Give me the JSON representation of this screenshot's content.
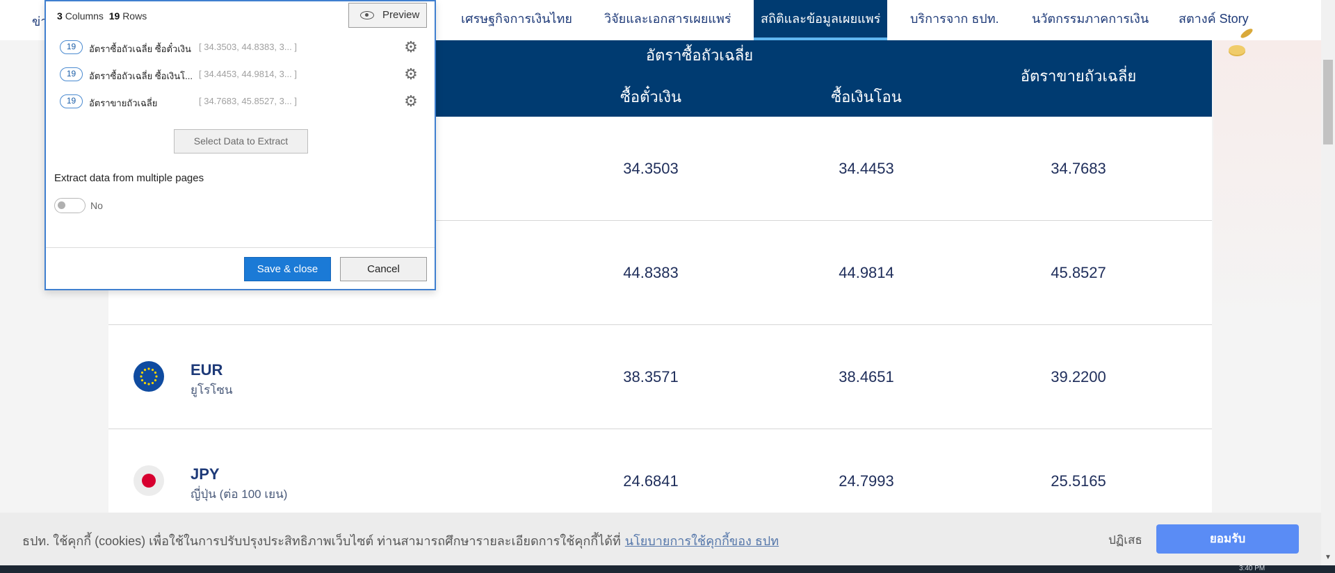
{
  "nav": {
    "cut_item": "ข่า",
    "items": [
      {
        "label": "เศรษฐกิจการเงินไทย"
      },
      {
        "label": "วิจัยและเอกสารเผยแพร่"
      },
      {
        "label": "สถิติและข้อมูลเผยแพร่"
      },
      {
        "label": "บริการจาก ธปท."
      },
      {
        "label": "นวัตกรรมภาคการเงิน"
      },
      {
        "label": "สตางค์ Story"
      }
    ],
    "active_index": 2
  },
  "table": {
    "group_header": "อัตราซื้อถัวเฉลี่ย",
    "col_buy_tt": "ซื้อตั๋วเงิน",
    "col_buy_transfer": "ซื้อเงินโอน",
    "col_sell": "อัตราขายถัวเฉลี่ย",
    "rows": [
      {
        "code": "",
        "name": "",
        "buy_tt": "34.3503",
        "buy_transfer": "34.4453",
        "sell": "34.7683"
      },
      {
        "code": "",
        "name": "",
        "buy_tt": "44.8383",
        "buy_transfer": "44.9814",
        "sell": "45.8527"
      },
      {
        "code": "EUR",
        "name": "ยูโรโซน",
        "buy_tt": "38.3571",
        "buy_transfer": "38.4651",
        "sell": "39.2200",
        "flag": "eu-flag-icon"
      },
      {
        "code": "JPY",
        "name": "ญี่ปุ่น (ต่อ 100 เยน)",
        "buy_tt": "24.6841",
        "buy_transfer": "24.7993",
        "sell": "25.5165",
        "flag": "jp-flag-icon"
      }
    ]
  },
  "dialog": {
    "columns_count": "3",
    "columns_word": "Columns",
    "rows_count": "19",
    "rows_word": "Rows",
    "preview_label": "Preview",
    "columns": [
      {
        "count": "19",
        "name": "อัตราซื้อถัวเฉลี่ย ซื้อตั๋วเงิน",
        "values": "[ 34.3503, 44.8383, 3...  ]"
      },
      {
        "count": "19",
        "name": "อัตราซื้อถัวเฉลี่ย ซื้อเงินโ...",
        "values": "[ 34.4453, 44.9814, 3...  ]"
      },
      {
        "count": "19",
        "name": "อัตราขายถัวเฉลี่ย",
        "values": "[ 34.7683, 45.8527, 3...  ]"
      }
    ],
    "select_label": "Select Data to Extract",
    "multi_label": "Extract data from multiple pages",
    "toggle_label": "No",
    "save_label": "Save & close",
    "cancel_label": "Cancel"
  },
  "cookie": {
    "text": "ธปท. ใช้คุกกี้ (cookies) เพื่อใช้ในการปรับปรุงประสิทธิภาพเว็บไซต์ ท่านสามารถศึกษารายละเอียดการใช้คุกกี้ได้ที่",
    "link": "นโยบายการใช้คุกกี้ของ ธปท",
    "reject": "ปฏิเสธ",
    "accept": "ยอมรับ"
  },
  "taskbar": {
    "time": "3:40 PM"
  },
  "colors": {
    "header_blue": "#003b71",
    "accent_blue": "#1b7ad6",
    "accept_blue": "#5a8cf5"
  }
}
